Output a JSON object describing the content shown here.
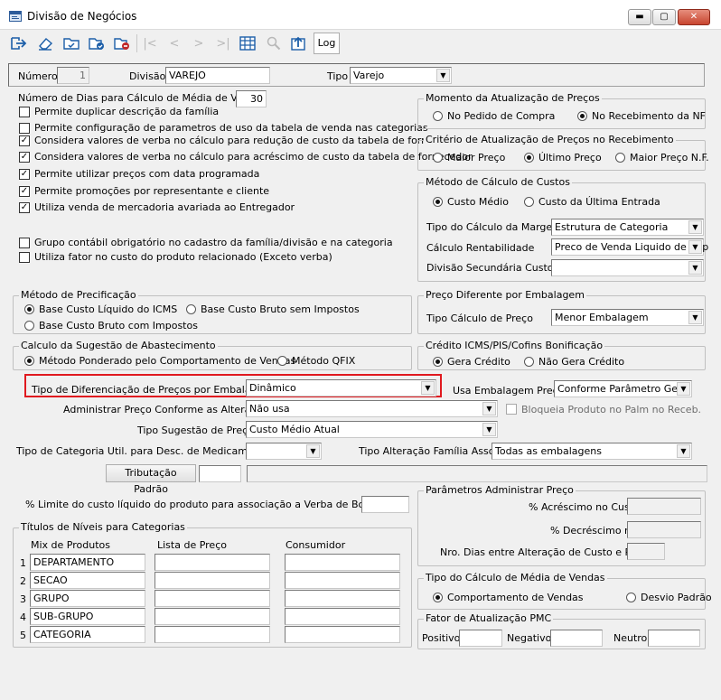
{
  "window": {
    "title": "Divisão de Negócios",
    "minimize": "▬",
    "maximize": "▢",
    "close": "✕"
  },
  "toolbar": {
    "log_label": "Log"
  },
  "header": {
    "numero_label": "Número",
    "numero_value": "1",
    "divisao_label": "Divisão",
    "divisao_value": "VAREJO",
    "tipo_label": "Tipo",
    "tipo_value": "Varejo"
  },
  "left": {
    "dias_label": "Número de Dias para Cálculo de Média de Vendas",
    "dias_value": "30",
    "checks": [
      {
        "label": "Permite duplicar descrição da família",
        "checked": false
      },
      {
        "label": "Permite configuração de parametros de uso da tabela de venda nas categorias",
        "checked": false
      },
      {
        "label": "Considera valores de verba no cálculo para redução de custo da tabela de fornecedor",
        "checked": true
      },
      {
        "label": "Considera valores de verba no cálculo para acréscimo de custo da tabela de fornecedor",
        "checked": true
      },
      {
        "label": "Permite utilizar preços com data programada",
        "checked": true
      },
      {
        "label": "Permite promoções por representante e cliente",
        "checked": true
      },
      {
        "label": "Utiliza venda de mercadoria avariada ao Entregador",
        "checked": true
      },
      {
        "label": "Grupo contábil obrigatório no cadastro da família/divisão e na categoria",
        "checked": false
      },
      {
        "label": "Utiliza fator no custo do produto relacionado (Exceto verba)",
        "checked": false
      }
    ]
  },
  "momento": {
    "title": "Momento da Atualização de Preços",
    "opt1": "No Pedido de Compra",
    "opt2": "No Recebimento da NF"
  },
  "criterio": {
    "title": "Critério de Atualização de Preços no Recebimento",
    "opt1": "Maior Preço",
    "opt2": "Último Preço",
    "opt3": "Maior Preço N.F."
  },
  "metodo_custos": {
    "title": "Método de Cálculo de Custos",
    "opt1": "Custo Médio",
    "opt2": "Custo da Última Entrada",
    "margem_label": "Tipo do Cálculo da Margem",
    "margem_value": "Estrutura de Categoria",
    "rent_label": "Cálculo Rentabilidade",
    "rent_value": "Preco de Venda Liquido de Imp",
    "div_label": "Divisão Secundária Custo",
    "div_value": ""
  },
  "precificacao": {
    "title": "Método de Precificação",
    "opt1": "Base Custo Líquido do ICMS",
    "opt2": "Base Custo Bruto sem Impostos",
    "opt3": "Base Custo Bruto com Impostos"
  },
  "embalagem": {
    "title": "Preço Diferente por Embalagem",
    "label": "Tipo Cálculo de Preço",
    "value": "Menor Embalagem"
  },
  "sugestao": {
    "title": "Calculo da Sugestão de Abastecimento",
    "opt1": "Método Ponderado pelo Comportamento de Vendas",
    "opt2": "Método QFIX"
  },
  "credito": {
    "title": "Crédito ICMS/PIS/Cofins Bonificação",
    "opt1": "Gera Crédito",
    "opt2": "Não Gera Crédito"
  },
  "middle": {
    "dif_label": "Tipo de Diferenciação de Preços por Embalagem",
    "dif_value": "Dinâmico",
    "usa_label": "Usa Embalagem Preço",
    "usa_value": "Conforme Parâmetro Geral",
    "adm_label": "Administrar Preço Conforme as Alterações",
    "adm_value": "Não usa",
    "bloq_label": "Bloqueia Produto no Palm no Receb.",
    "tps_label": "Tipo Sugestão de Preço",
    "tps_value": "Custo Médio Atual",
    "cat_label": "Tipo de Categoria Util. para Desc. de  Medicamentos",
    "cat_value": "",
    "alt_label": "Tipo Alteração Família Assoc.",
    "alt_value": "Todas as embalagens",
    "trib_label": "Tributação Padrão",
    "perc_label": "% Limite do custo líquido do produto para associação a Verba de Bonificação"
  },
  "titulos": {
    "title": "Títulos de Níveis para Categorias",
    "col1": "Mix de Produtos",
    "col2": "Lista de Preço",
    "col3": "Consumidor",
    "rows": [
      {
        "n": "1",
        "mix": "DEPARTAMENTO"
      },
      {
        "n": "2",
        "mix": "SECAO"
      },
      {
        "n": "3",
        "mix": "GRUPO"
      },
      {
        "n": "4",
        "mix": "SUB-GRUPO"
      },
      {
        "n": "5",
        "mix": "CATEGORIA"
      }
    ]
  },
  "adm_preco": {
    "title": "Parâmetros Administrar Preço",
    "acr_label": "% Acréscimo no Custo",
    "dec_label": "% Decréscimo no",
    "dias_label": "Nro. Dias entre Alteração de Custo e Preço"
  },
  "media_vendas": {
    "title": "Tipo do Cálculo de Média de Vendas",
    "opt1": "Comportamento de Vendas",
    "opt2": "Desvio Padrão"
  },
  "pmc": {
    "title": "Fator de Atualização PMC",
    "pos": "Positivo",
    "neg": "Negativo",
    "neu": "Neutro"
  }
}
